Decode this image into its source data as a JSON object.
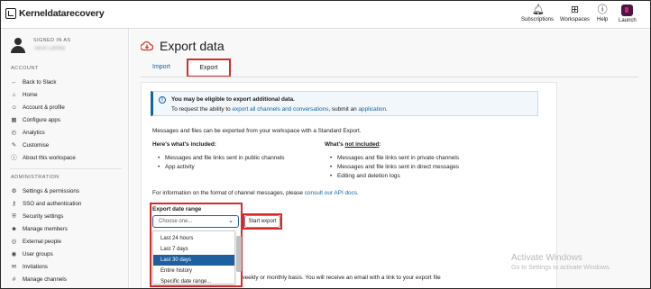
{
  "topbar": {
    "brand": "Kerneldatarecovery",
    "nav": [
      {
        "label": "Subscriptions",
        "icon": "bell-icon"
      },
      {
        "label": "Workspaces",
        "icon": "grid-icon"
      },
      {
        "label": "Help",
        "icon": "help-icon"
      },
      {
        "label": "Launch",
        "icon": "slack-icon"
      }
    ]
  },
  "sidebar": {
    "signed_in_as": "SIGNED IN AS",
    "username": "Tarun Lamba",
    "account_header": "ACCOUNT",
    "account_items": [
      {
        "label": "Back to Slack",
        "icon": "arrow-left-icon"
      },
      {
        "label": "Home",
        "icon": "home-icon"
      },
      {
        "label": "Account & profile",
        "icon": "user-icon"
      },
      {
        "label": "Configure apps",
        "icon": "apps-icon"
      },
      {
        "label": "Analytics",
        "icon": "analytics-icon"
      },
      {
        "label": "Customise",
        "icon": "brush-icon"
      },
      {
        "label": "About this workspace",
        "icon": "info-icon"
      }
    ],
    "admin_header": "ADMINISTRATION",
    "admin_items": [
      {
        "label": "Settings & permissions",
        "icon": "gear-icon"
      },
      {
        "label": "SSO and authentication",
        "icon": "key-icon"
      },
      {
        "label": "Security settings",
        "icon": "shield-icon"
      },
      {
        "label": "Manage members",
        "icon": "members-icon"
      },
      {
        "label": "External people",
        "icon": "globe-icon"
      },
      {
        "label": "User groups",
        "icon": "group-icon"
      },
      {
        "label": "Invitations",
        "icon": "invite-icon"
      },
      {
        "label": "Manage channels",
        "icon": "channel-icon"
      }
    ]
  },
  "page": {
    "title": "Export data",
    "tabs": {
      "import": "Import",
      "export": "Export"
    },
    "notice": {
      "title": "You may be eligible to export additional data.",
      "body_prefix": "To request the ability to ",
      "body_link1": "export all channels and conversations",
      "body_mid": ", submit an ",
      "body_link2": "application",
      "body_suffix": "."
    },
    "intro": "Messages and files can be exported from your workspace with a Standard Export.",
    "included_heading": "Here's what's included:",
    "included": [
      "Messages and file links sent in public channels",
      "App activity"
    ],
    "not_included_prefix": "What's ",
    "not_included_word": "not included",
    "not_included_suffix": ":",
    "not_included": [
      "Messages and file links sent in private channels",
      "Messages and file links sent in direct messages",
      "Editing and deletion logs"
    ],
    "format_prefix": "For information on the format of channel messages, please ",
    "format_link": "consult our API docs",
    "format_suffix": ".",
    "range_label": "Export date range",
    "select_placeholder": "Choose one...",
    "start_button": "Start export",
    "options": [
      "Last 24 hours",
      "Last 7 days",
      "Last 30 days",
      "Entire history",
      "Specific date range..."
    ],
    "selected_option": "Last 30 days",
    "schedule_line": "weekly or monthly basis. You will receive an email with a link to your export file"
  },
  "watermark": {
    "title": "Activate Windows",
    "subtitle": "Go to Settings to activate Windows."
  }
}
